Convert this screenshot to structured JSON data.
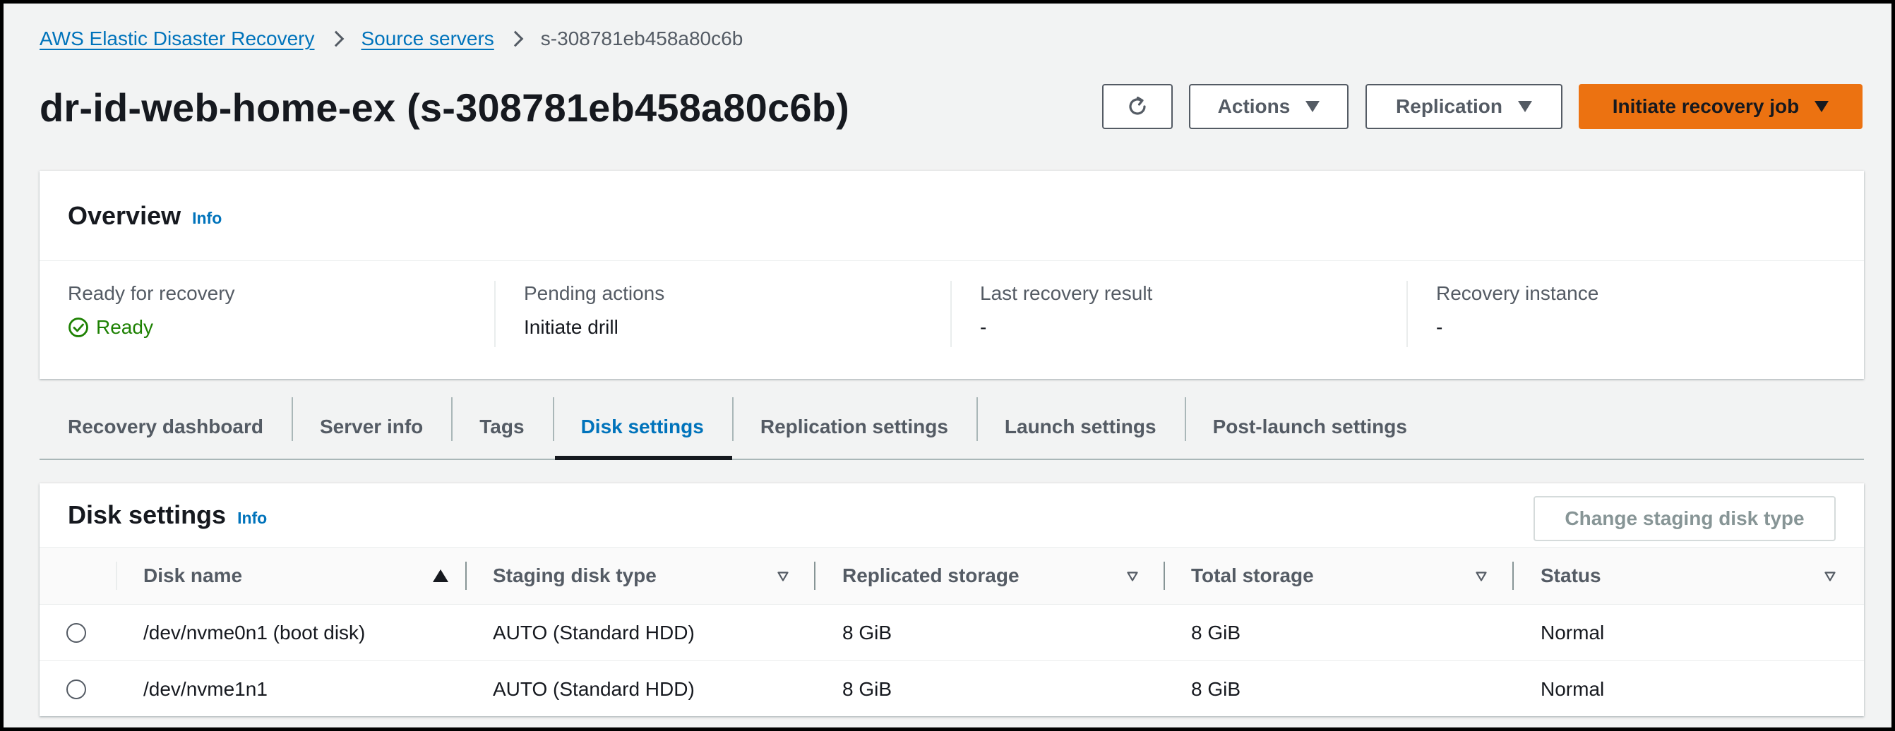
{
  "breadcrumb": {
    "items": [
      "AWS Elastic Disaster Recovery",
      "Source servers"
    ],
    "current": "s-308781eb458a80c6b"
  },
  "header": {
    "title": "dr-id-web-home-ex (s-308781eb458a80c6b)",
    "actions_label": "Actions",
    "replication_label": "Replication",
    "initiate_label": "Initiate recovery job"
  },
  "overview": {
    "title": "Overview",
    "info": "Info",
    "fields": [
      {
        "label": "Ready for recovery",
        "value": "Ready"
      },
      {
        "label": "Pending actions",
        "value": "Initiate drill"
      },
      {
        "label": "Last recovery result",
        "value": "-"
      },
      {
        "label": "Recovery instance",
        "value": "-"
      }
    ]
  },
  "tabs": [
    "Recovery dashboard",
    "Server info",
    "Tags",
    "Disk settings",
    "Replication settings",
    "Launch settings",
    "Post-launch settings"
  ],
  "active_tab": "Disk settings",
  "disk_settings": {
    "title": "Disk settings",
    "info": "Info",
    "change_button": "Change staging disk type",
    "columns": [
      "Disk name",
      "Staging disk type",
      "Replicated storage",
      "Total storage",
      "Status"
    ],
    "rows": [
      [
        "/dev/nvme0n1 (boot disk)",
        "AUTO (Standard HDD)",
        "8 GiB",
        "8 GiB",
        "Normal"
      ],
      [
        "/dev/nvme1n1",
        "AUTO (Standard HDD)",
        "8 GiB",
        "8 GiB",
        "Normal"
      ]
    ]
  },
  "colors": {
    "primary": "#ec7211",
    "link": "#0073bb",
    "success": "#1d8102",
    "text": "#16191f",
    "muted": "#545b64"
  },
  "icons": {
    "refresh": "refresh-icon",
    "ready": "check-circle-icon",
    "sort_asc": "sort-ascending-icon",
    "sort": "sort-descending-icon"
  }
}
